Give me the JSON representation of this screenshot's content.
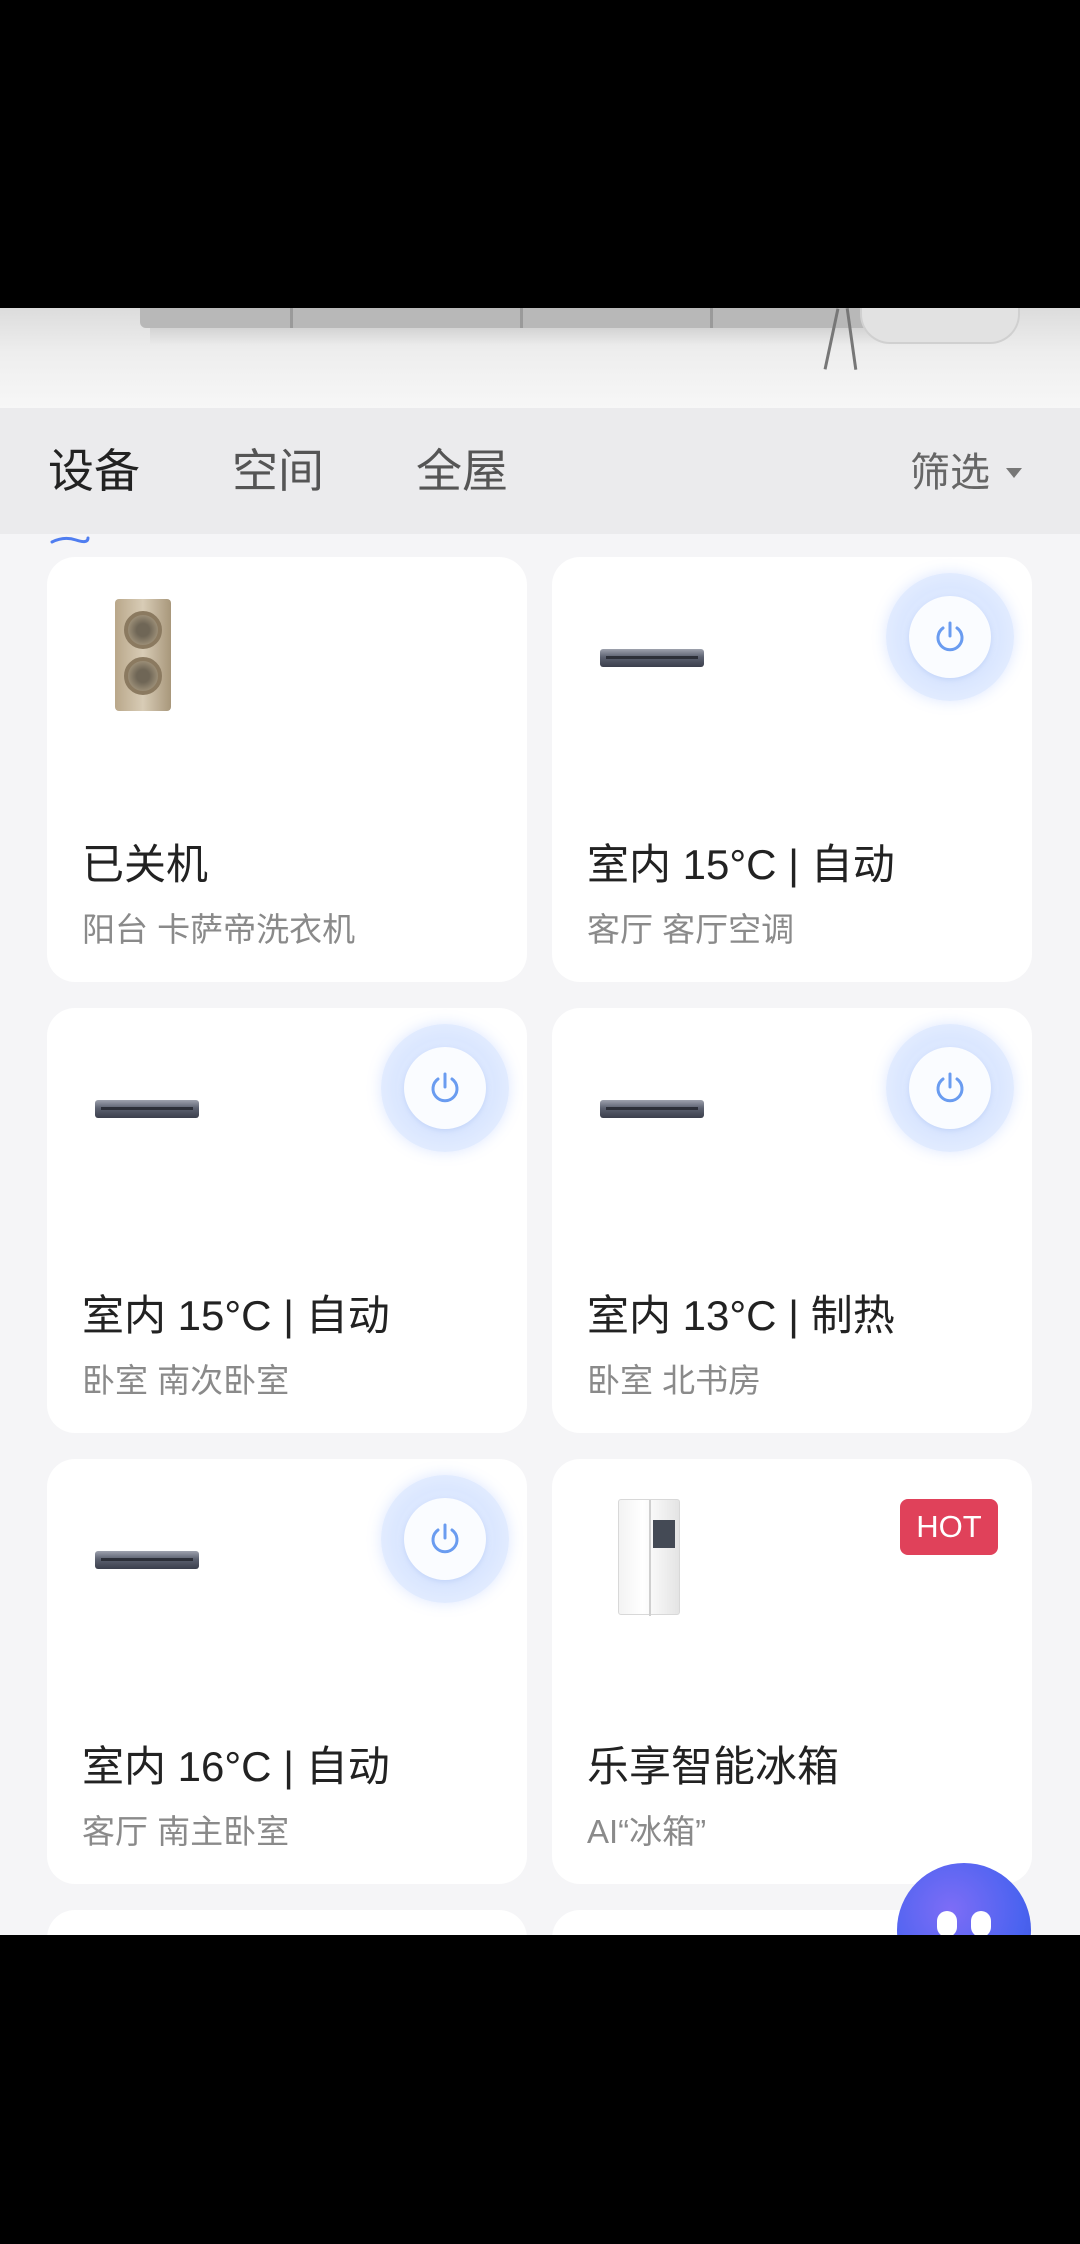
{
  "tabs": [
    {
      "label": "设备",
      "active": true
    },
    {
      "label": "空间",
      "active": false
    },
    {
      "label": "全屋",
      "active": false
    }
  ],
  "filter": {
    "label": "筛选"
  },
  "devices": [
    {
      "status": "已关机",
      "location": "阳台 卡萨帝洗衣机",
      "icon": "washing-machine",
      "power_button": false
    },
    {
      "status": "室内 15°C | 自动",
      "location": "客厅 客厅空调",
      "icon": "air-conditioner",
      "power_button": true
    },
    {
      "status": "室内 15°C | 自动",
      "location": "卧室 南次卧室",
      "icon": "air-conditioner",
      "power_button": true
    },
    {
      "status": "室内 13°C | 制热",
      "location": "卧室 北书房",
      "icon": "air-conditioner",
      "power_button": true
    },
    {
      "status": "室内 16°C | 自动",
      "location": "客厅 南主卧室",
      "icon": "air-conditioner",
      "power_button": true
    },
    {
      "status": "乐享智能冰箱",
      "location": "AI“冰箱”",
      "icon": "refrigerator",
      "badge": "HOT",
      "power_button": false
    }
  ],
  "colors": {
    "background": "#f5f5f7",
    "card": "#ffffff",
    "hot_badge": "#e0415a",
    "power_glow": "#dbe7ff",
    "power_icon": "#6a9cf0",
    "assistant": "#4b63f0"
  },
  "assistant_icon": "robot-assistant-icon"
}
